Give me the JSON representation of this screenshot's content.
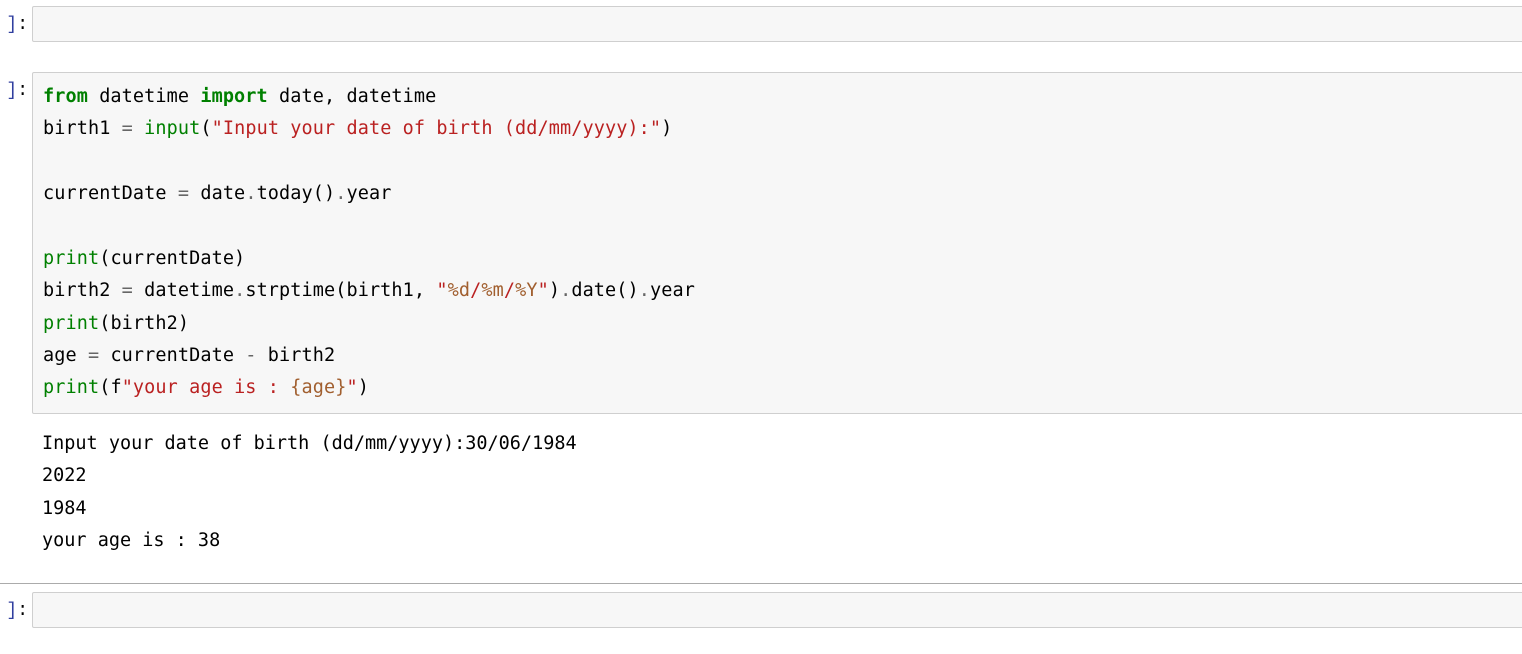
{
  "prompt_open": "]",
  "prompt_colon": ":",
  "cells": {
    "cell0": {
      "empty": true
    },
    "cell1": {
      "code_tokens": {
        "l1": {
          "t1": "from",
          "t2": " datetime ",
          "t3": "import",
          "t4": " date, datetime"
        },
        "l2": {
          "t1": "birth1 ",
          "t2": "=",
          "t3": " ",
          "t4": "input",
          "t5": "(",
          "t6": "\"Input your date of birth (dd/mm/yyyy):\"",
          "t7": ")"
        },
        "l3": "",
        "l4": {
          "t1": "currentDate ",
          "t2": "=",
          "t3": " date",
          "t4": ".",
          "t5": "today()",
          "t6": ".",
          "t7": "year"
        },
        "l5": "",
        "l6": {
          "t1": "print",
          "t2": "(currentDate)"
        },
        "l7": {
          "t1": "birth2 ",
          "t2": "=",
          "t3": " datetime",
          "t4": ".",
          "t5": "strptime(birth1, ",
          "t6": "\"",
          "t7": "%d",
          "t8": "/",
          "t9": "%m",
          "t10": "/",
          "t11": "%Y",
          "t12": "\"",
          "t13": ")",
          "t14": ".",
          "t15": "date()",
          "t16": ".",
          "t17": "year"
        },
        "l8": {
          "t1": "print",
          "t2": "(birth2)"
        },
        "l9": {
          "t1": "age ",
          "t2": "=",
          "t3": " currentDate ",
          "t4": "-",
          "t5": " birth2"
        },
        "l10": {
          "t1": "print",
          "t2": "(f",
          "t3": "\"your age is : ",
          "t4": "{age}",
          "t5": "\"",
          "t6": ")"
        }
      },
      "output": "Input your date of birth (dd/mm/yyyy):30/06/1984\n2022\n1984\nyour age is : 38"
    },
    "cell2": {
      "empty": true
    }
  }
}
